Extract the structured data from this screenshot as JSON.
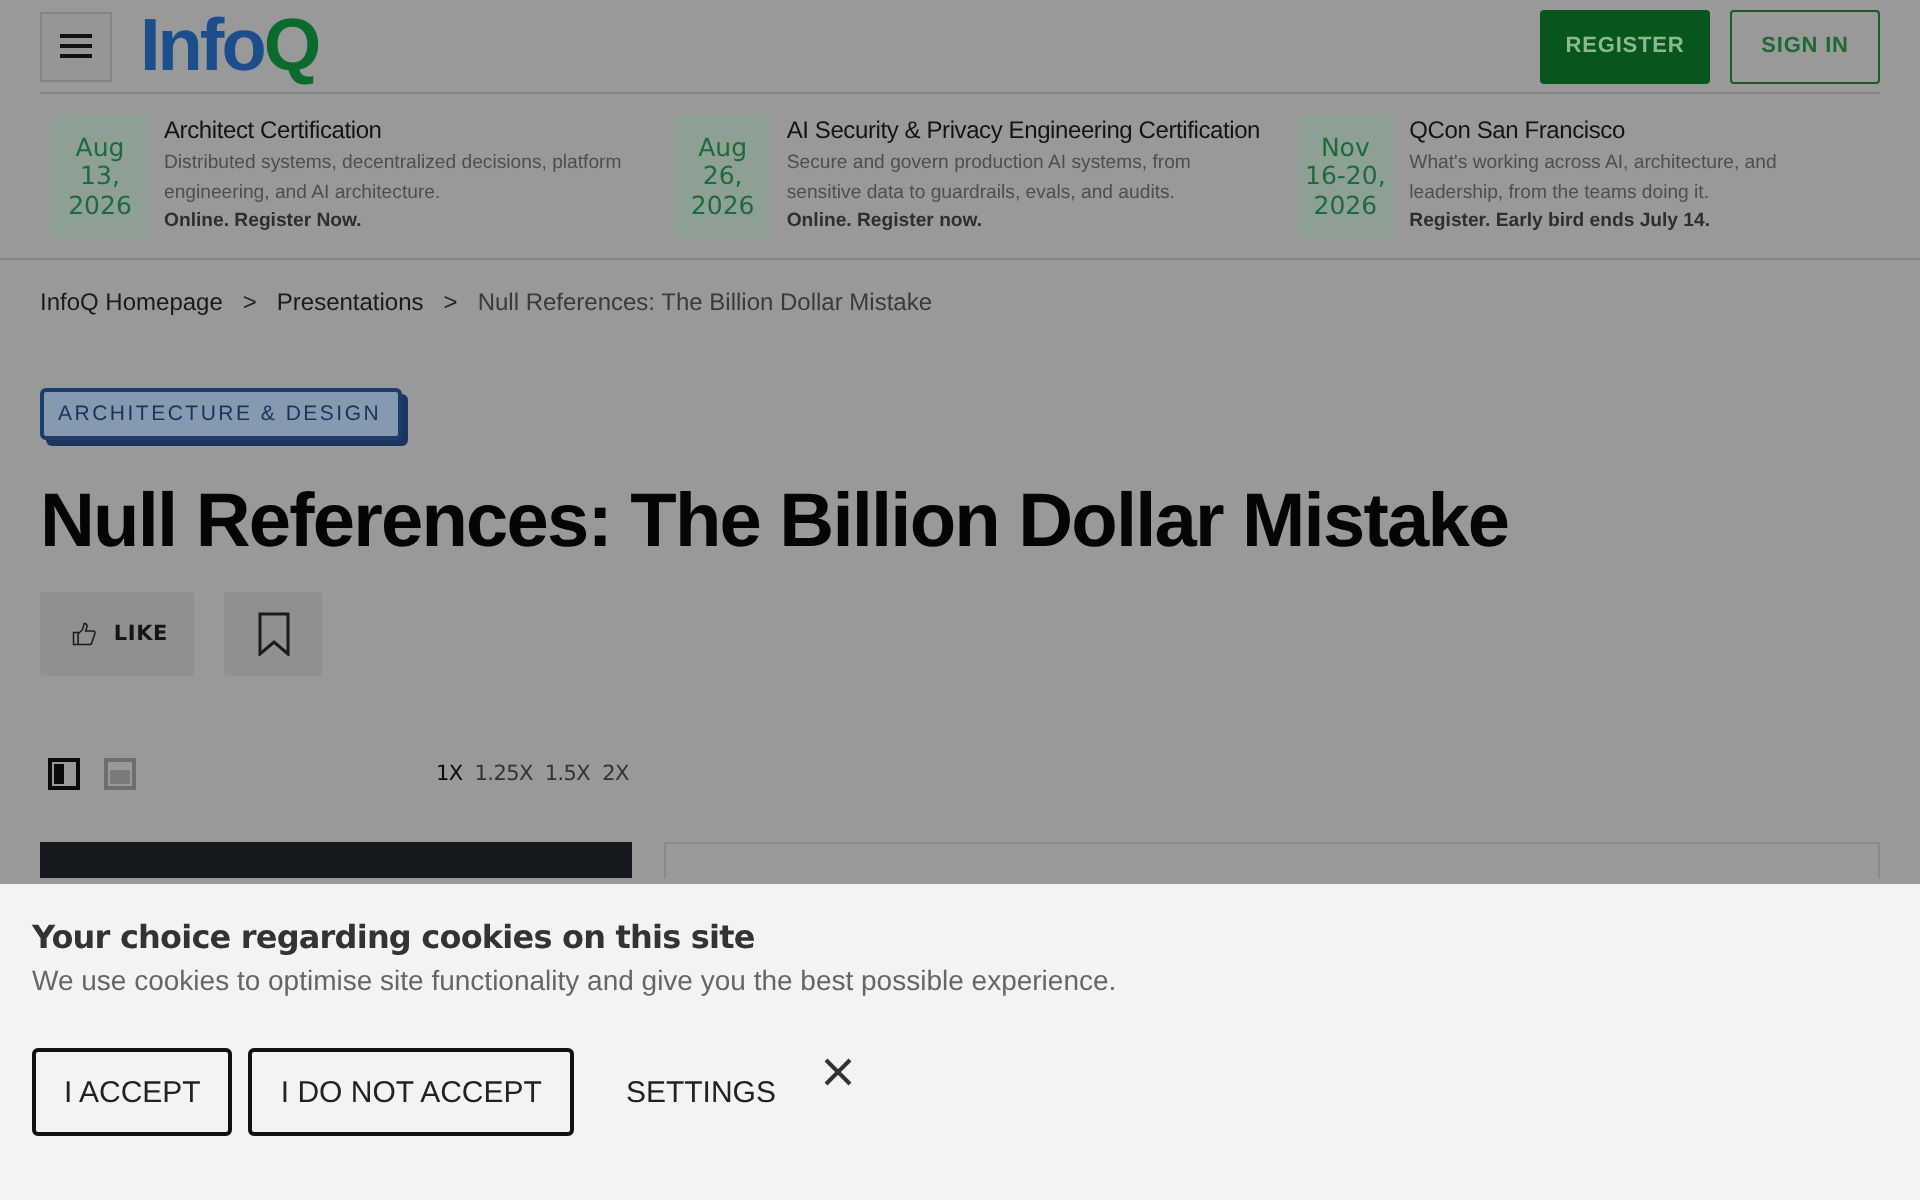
{
  "header": {
    "logo": [
      {
        "text": "Info",
        "color": "#1d4e8c"
      },
      {
        "text": "Q",
        "color": "#0b6a2e"
      }
    ],
    "buttons": [
      {
        "label": "REGISTER",
        "kind": "filled"
      },
      {
        "label": "SIGN IN",
        "kind": "outline"
      }
    ]
  },
  "events": [
    {
      "date_lines": [
        "Aug",
        "13,",
        "2026"
      ],
      "title": "Architect Certification",
      "description": "Distributed systems, decentralized decisions, platform engineering, and AI architecture.",
      "call_to_action": "Online. Register Now."
    },
    {
      "date_lines": [
        "Aug",
        "26,",
        "2026"
      ],
      "title": "AI Security & Privacy Engineering Certification",
      "description": "Secure and govern production AI systems, from sensitive data to guardrails, evals, and audits.",
      "call_to_action": "Online. Register now."
    },
    {
      "date_lines": [
        "Nov",
        "16-20,",
        "2026"
      ],
      "title": "QCon San Francisco",
      "description": "What's working across AI, architecture, and leadership, from the teams doing it.",
      "call_to_action": "Register. Early bird ends July 14."
    }
  ],
  "breadcrumbs": {
    "items": [
      {
        "label": "InfoQ Homepage",
        "current": false
      },
      {
        "label": "Presentations",
        "current": false
      },
      {
        "label": "Null References: The Billion Dollar Mistake",
        "current": true
      }
    ],
    "separators": [
      ">",
      ">"
    ]
  },
  "topic_tag": "ARCHITECTURE & DESIGN",
  "title": "Null References: The Billion Dollar Mistake",
  "actions": [
    {
      "kind": "like",
      "label": "LIKE"
    },
    {
      "kind": "bookmark"
    }
  ],
  "view_modes": [
    {
      "kind": "split",
      "selected": true
    },
    {
      "kind": "stacked",
      "selected": false
    }
  ],
  "speeds": [
    {
      "label": "1X",
      "selected": true
    },
    {
      "label": "1.25X",
      "selected": false
    },
    {
      "label": "1.5X",
      "selected": false
    },
    {
      "label": "2X",
      "selected": false
    }
  ],
  "cookie_banner": {
    "title": "Your choice regarding cookies on this site",
    "text": "We use cookies to optimise site functionality and give you the best possible experience.",
    "buttons": [
      {
        "label": "I ACCEPT",
        "kind": "outlined"
      },
      {
        "label": "I DO NOT ACCEPT",
        "kind": "outlined"
      },
      {
        "label": "SETTINGS",
        "kind": "text"
      }
    ],
    "closable": true
  }
}
